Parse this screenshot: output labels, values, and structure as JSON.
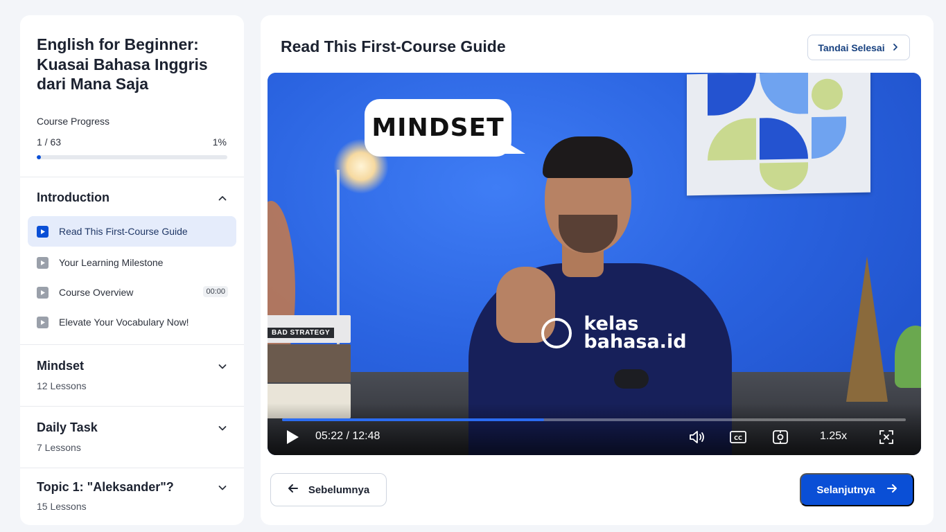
{
  "sidebar": {
    "course_title": "English for Beginner: Kuasai Bahasa Inggris dari Mana Saja",
    "progress": {
      "label": "Course Progress",
      "count": "1 / 63",
      "percent_text": "1%",
      "fraction": 0.01
    },
    "sections": [
      {
        "title": "Introduction",
        "expanded": true,
        "icon": "chevron-up-icon",
        "lessons": [
          {
            "label": "Read This First-Course Guide",
            "active": true,
            "icon": "play-icon"
          },
          {
            "label": "Your Learning Milestone",
            "active": false,
            "icon": "play-icon"
          },
          {
            "label": "Course Overview",
            "active": false,
            "icon": "play-icon",
            "duration": "00:00"
          },
          {
            "label": "Elevate Your Vocabulary Now!",
            "active": false,
            "icon": "play-icon"
          }
        ]
      },
      {
        "title": "Mindset",
        "subtitle": "12 Lessons",
        "expanded": false,
        "icon": "chevron-down-icon"
      },
      {
        "title": "Daily Task",
        "subtitle": "7 Lessons",
        "expanded": false,
        "icon": "chevron-down-icon"
      },
      {
        "title": "Topic 1: \"Aleksander\"?",
        "subtitle": "15 Lessons",
        "expanded": false,
        "icon": "chevron-down-icon"
      }
    ]
  },
  "main": {
    "lesson_title": "Read This First-Course Guide",
    "mark_done_label": "Tandai Selesai",
    "video": {
      "speech_bubble": "MINDSET",
      "book_spine": "BAD STRATEGY",
      "shirt_logo_line1": "kelas",
      "shirt_logo_line2": "bahasa.id",
      "time": "05:22 / 12:48",
      "played_fraction": 0.42,
      "speed": "1.25x",
      "icons": [
        "play-icon",
        "volume-icon",
        "captions-icon",
        "settings-icon",
        "fullscreen-icon"
      ]
    },
    "prev_label": "Sebelumnya",
    "next_label": "Selanjutnya"
  },
  "colors": {
    "accent": "#0a4fd6",
    "active_lesson_bg": "#e5ecfb",
    "page_bg": "#f3f5f9"
  }
}
